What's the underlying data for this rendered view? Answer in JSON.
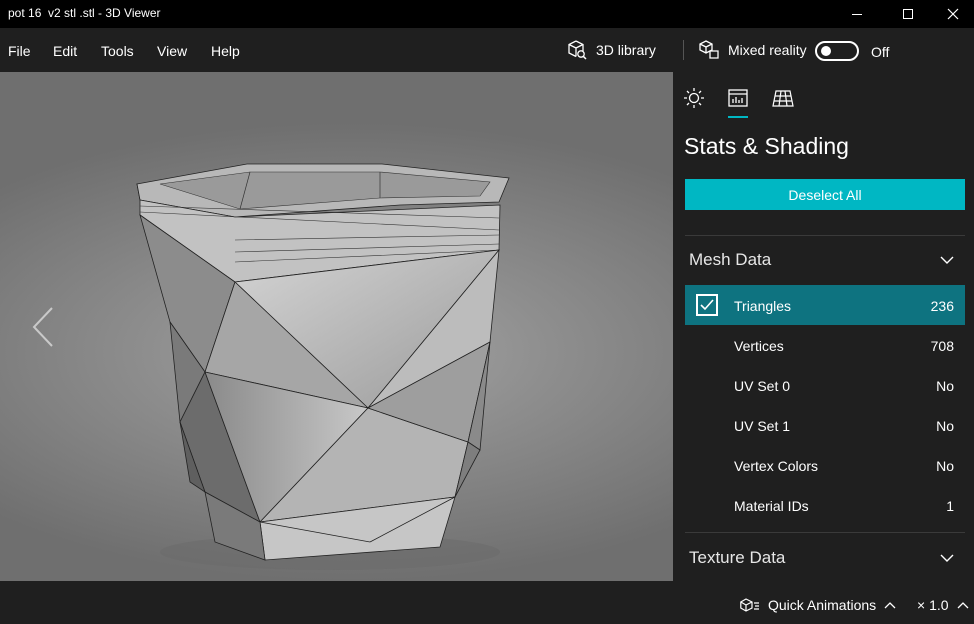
{
  "window": {
    "title": "pot 16  v2 stl .stl - 3D Viewer"
  },
  "menu": {
    "items": [
      "File",
      "Edit",
      "Tools",
      "View",
      "Help"
    ]
  },
  "toolbar": {
    "library_label": "3D library",
    "mixed_reality_label": "Mixed reality",
    "mixed_reality_state": "Off"
  },
  "panel": {
    "tabs": [
      "lighting-icon",
      "stats-icon",
      "grid-icon"
    ],
    "active_tab": "stats-icon",
    "title": "Stats & Shading",
    "deselect_label": "Deselect All",
    "mesh_section": "Mesh Data",
    "mesh_rows": [
      {
        "label": "Triangles",
        "value": "236",
        "checked": true
      },
      {
        "label": "Vertices",
        "value": "708"
      },
      {
        "label": "UV Set 0",
        "value": "No"
      },
      {
        "label": "UV Set 1",
        "value": "No"
      },
      {
        "label": "Vertex Colors",
        "value": "No"
      },
      {
        "label": "Material IDs",
        "value": "1"
      }
    ],
    "texture_section": "Texture Data"
  },
  "bottom": {
    "quick_animations_label": "Quick Animations",
    "speed_label": "× 1.0"
  },
  "colors": {
    "accent": "#00b7c3",
    "selected_row": "#0e7380",
    "panel_bg": "#1f1f1f",
    "titlebar_bg": "#000000"
  }
}
